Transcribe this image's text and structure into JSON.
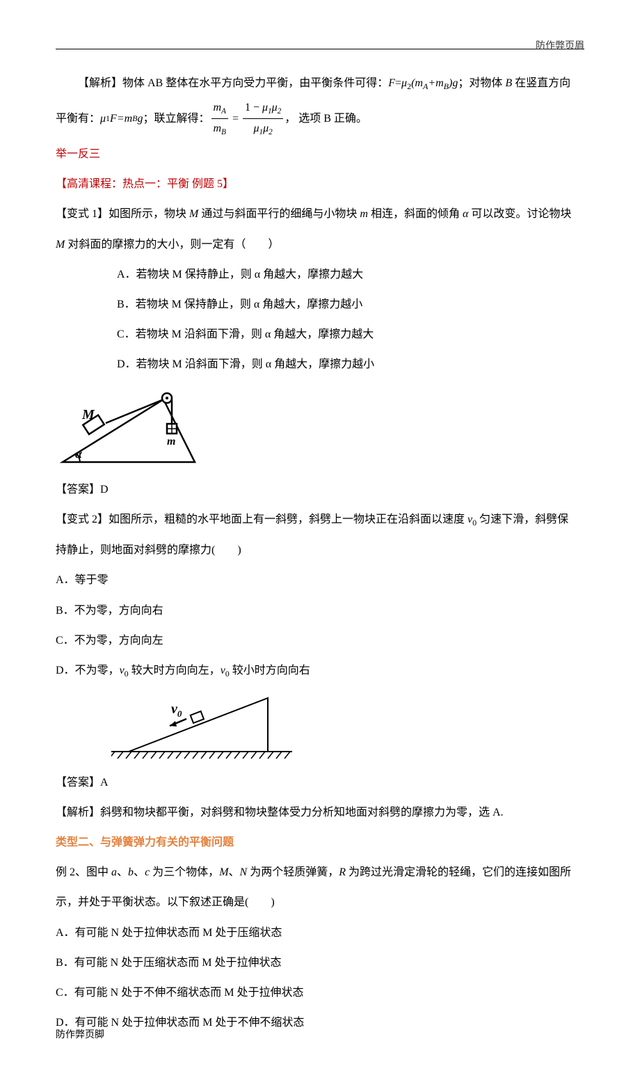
{
  "header": {
    "right": "防作弊页眉"
  },
  "footer": {
    "left": "防作弊页脚"
  },
  "solution_intro": {
    "prefix": "【解析】物体 AB 整体在水平方向受力平衡，由平衡条件可得：",
    "eq1_lhs": "F",
    "eq1_rhs1": "μ",
    "eq1_sub1": "2",
    "eq1_rhs2": "(m",
    "eq1_subA": "A",
    "eq1_rhs3": "+m",
    "eq1_subB": "B",
    "eq1_rhs4": ")g",
    "mid": "；对物体 ",
    "objB": "B",
    "tail": " 在竖直方向"
  },
  "solution_line2": {
    "prefix": "平衡有：",
    "mu": "μ",
    "s1": "1",
    "eqF": "F=m",
    "sB": "B",
    "g": "g",
    "mid": "；联立解得：",
    "frac1_num_mA": "m",
    "frac1_num_sub": "A",
    "frac1_den_mB": "m",
    "frac1_den_sub": "B",
    "equals": "=",
    "frac2_num": "1−μ",
    "frac2_num_s1": "1",
    "frac2_num_mu2": "μ",
    "frac2_num_s2": "2",
    "frac2_den_mu1": "μ",
    "frac2_den_s1": "1",
    "frac2_den_mu2": "μ",
    "frac2_den_s2": "2",
    "tail": "， 选项 B 正确。"
  },
  "sec1": {
    "title": "举一反三",
    "subtitle": "【高清课程：热点一：平衡 例题 5】",
    "v1_label": "【变式 1】",
    "v1_text1": "如图所示，物块 ",
    "v1_M": "M",
    "v1_text2": " 通过与斜面平行的细绳与小物块 ",
    "v1_m": "m",
    "v1_text3": " 相连，斜面的倾角 ",
    "v1_alpha": "α",
    "v1_text4": " 可以改变。讨论物块",
    "v1_line2a": "M",
    "v1_line2b": " 对斜面的摩擦力的大小，则一定有（　　）",
    "optA": "A．若物块 M 保持静止，则 α 角越大，摩擦力越大",
    "optB": "B．若物块 M 保持静止，则 α 角越大，摩擦力越小",
    "optC": "C．若物块 M 沿斜面下滑，则 α 角越大，摩擦力越大",
    "optD": "D．若物块 M 沿斜面下滑，则 α 角越大，摩擦力越小",
    "ans": "【答案】D"
  },
  "sec2": {
    "v2_label": "【变式 2】",
    "v2_text1": "如图所示，粗糙的水平地面上有一斜劈，斜劈上一物块正在沿斜面以速度 ",
    "v0": "v",
    "v0sub": "0",
    "v2_text2": " 匀速下滑，斜劈保",
    "v2_line2": "持静止，则地面对斜劈的摩擦力(　　)",
    "optA": "A．等于零",
    "optB": "B．不为零，方向向右",
    "optC": "C．不为零，方向向左",
    "optD_a": "D．不为零，",
    "optD_v": "v",
    "optD_s": "0",
    "optD_b": " 较大时方向向左，",
    "optD_v2": "v",
    "optD_s2": "0",
    "optD_c": " 较小时方向向右",
    "ans": "【答案】A",
    "expl": "【解析】斜劈和物块都平衡，对斜劈和物块整体受力分析知地面对斜劈的摩擦力为零，选 A."
  },
  "sec3": {
    "title": "类型二、与弹簧弹力有关的平衡问题",
    "ex_label": "例 2、",
    "ex_text1": "图中 ",
    "a": "a",
    "b": "b",
    "c": "c",
    "sep": "、",
    "ex_text2": " 为三个物体，",
    "M": "M",
    "N": "N",
    "ex_text3": " 为两个轻质弹簧，",
    "R": "R",
    "ex_text4": " 为跨过光滑定滑轮的轻绳，它们的连接如图所",
    "ex_line2": "示，并处于平衡状态。以下叙述正确是(　　)",
    "optA": "A．有可能 N 处于拉伸状态而 M 处于压缩状态",
    "optB": "B．有可能 N 处于压缩状态而 M 处于拉伸状态",
    "optC": "C．有可能 N 处于不伸不缩状态而 M 处于拉伸状态",
    "optD": "D．有可能 N 处于拉伸状态而 M 处于不伸不缩状态"
  },
  "fig": {
    "M": "M",
    "m": "m",
    "alpha": "α",
    "v0": "v",
    "v0sub": "0"
  }
}
